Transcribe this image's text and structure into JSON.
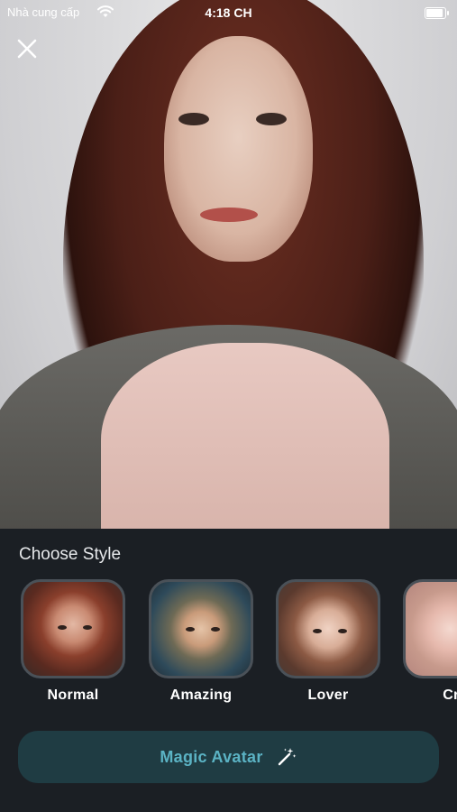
{
  "status_bar": {
    "carrier": "Nhà cung cấp",
    "time": "4:18 CH"
  },
  "panel": {
    "title": "Choose Style",
    "styles": [
      {
        "label": "Normal"
      },
      {
        "label": "Amazing"
      },
      {
        "label": "Lover"
      },
      {
        "label": "Cra"
      }
    ],
    "action_button": {
      "label": "Magic Avatar",
      "icon": "magic-wand-icon"
    }
  },
  "colors": {
    "panel_bg": "#1b1f24",
    "button_bg": "#1f3c43",
    "button_text": "#5bb3c4",
    "thumb_border": "#4a5158"
  }
}
